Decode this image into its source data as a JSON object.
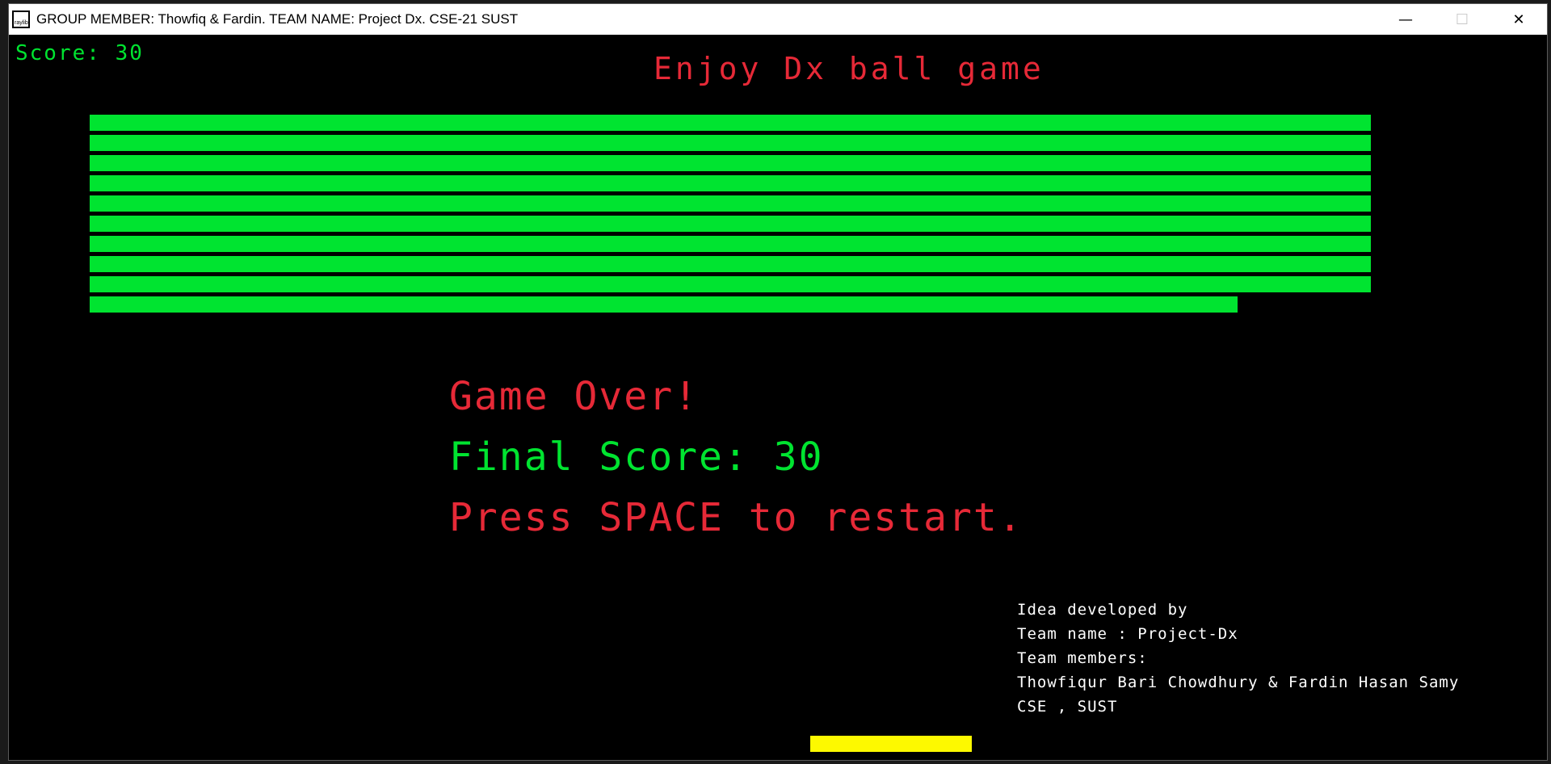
{
  "window": {
    "title": "GROUP MEMBER: Thowfiq & Fardin. TEAM NAME: Project Dx. CSE-21 SUST",
    "icon_label": "raylib",
    "minimize_symbol": "—",
    "maximize_symbol": "☐",
    "close_symbol": "✕"
  },
  "hud": {
    "score_label": "Score: 30"
  },
  "game": {
    "title": "Enjoy Dx ball game",
    "game_over": "Game Over!",
    "final_score": "Final Score: 30",
    "restart_prompt": "Press SPACE to restart."
  },
  "bricks": {
    "rows": [
      1,
      1,
      1,
      1,
      1,
      1,
      1,
      1,
      1,
      0.896
    ],
    "color": "#00e430"
  },
  "credits": {
    "line1": "Idea developed by",
    "line2": "Team name : Project-Dx",
    "line3": "Team members:",
    "line4": "Thowfiqur Bari Chowdhury & Fardin Hasan Samy",
    "line5": "CSE , SUST"
  },
  "colors": {
    "red": "#e62937",
    "green": "#00e430",
    "paddle": "#fdf900",
    "background": "#000000"
  }
}
